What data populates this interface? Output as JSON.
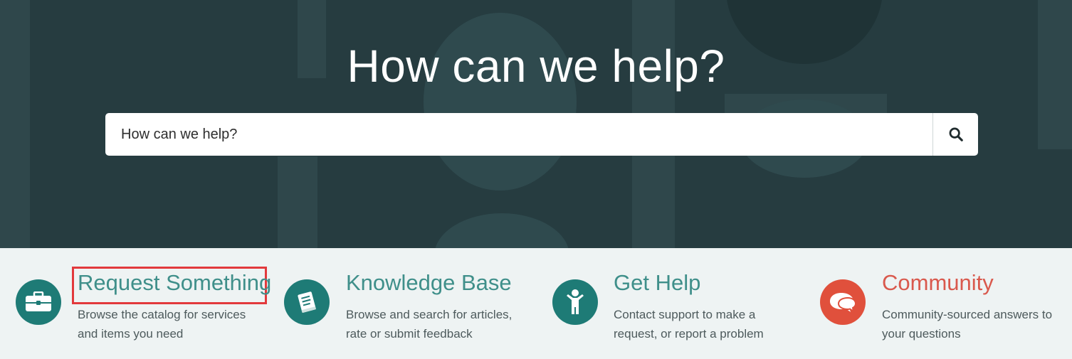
{
  "hero": {
    "title": "How can we help?"
  },
  "search": {
    "placeholder": "How can we help?",
    "button_icon": "search-icon"
  },
  "features": [
    {
      "title": "Request Something",
      "description": "Browse the catalog for services and items you need",
      "icon": "briefcase-icon",
      "color": "#3f8f8a",
      "highlighted": true
    },
    {
      "title": "Knowledge Base",
      "description": "Browse and search for articles, rate or submit feedback",
      "icon": "book-icon",
      "color": "#3f8f8a"
    },
    {
      "title": "Get Help",
      "description": "Contact support to make a request, or report a problem",
      "icon": "person-icon",
      "color": "#3f8f8a"
    },
    {
      "title": "Community",
      "description": "Community-sourced answers to your questions",
      "icon": "chat-bubbles-icon",
      "color": "#d9594d"
    }
  ],
  "colors": {
    "hero_bg": "#263c40",
    "accent_teal": "#1e7b76",
    "accent_red": "#e0503c",
    "highlight": "#e2393c"
  }
}
